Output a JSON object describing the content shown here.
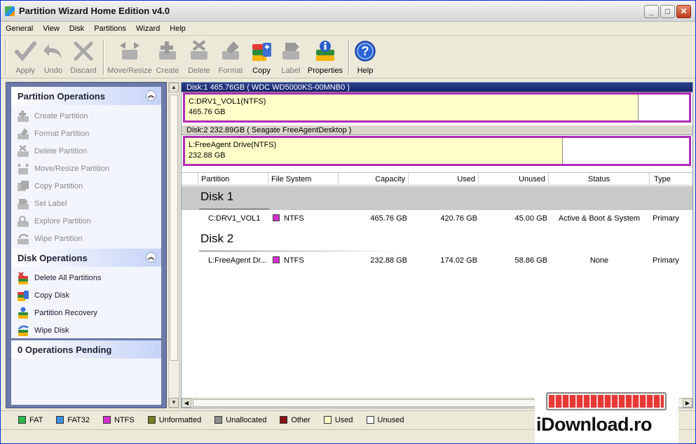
{
  "window": {
    "title": "Partition Wizard Home Edition v4.0"
  },
  "menu": [
    "General",
    "View",
    "Disk",
    "Partitions",
    "Wizard",
    "Help"
  ],
  "toolbar": {
    "apply": "Apply",
    "undo": "Undo",
    "discard": "Discard",
    "move_resize": "Move/Resize",
    "create": "Create",
    "delete": "Delete",
    "format": "Format",
    "copy": "Copy",
    "label": "Label",
    "properties": "Properties",
    "help": "Help"
  },
  "partition_operations": {
    "title": "Partition Operations",
    "items": [
      "Create Partition",
      "Format Partition",
      "Delete Partition",
      "Move/Resize Partition",
      "Copy Partition",
      "Set Label",
      "Explore Partition",
      "Wipe Partition"
    ]
  },
  "disk_operations": {
    "title": "Disk Operations",
    "items": [
      "Delete All Partitions",
      "Copy Disk",
      "Partition Recovery",
      "Wipe Disk"
    ]
  },
  "pending": {
    "title": "0 Operations Pending"
  },
  "diskmap": {
    "disk1": {
      "header": "Disk:1 465.76GB  ( WDC WD5000KS-00MNB0 )",
      "part_name": "C:DRV1_VOL1(NTFS)",
      "part_size": "465.76 GB",
      "used_fraction": 0.9
    },
    "disk2": {
      "header": "Disk:2 232.89GB  ( Seagate FreeAgentDesktop )",
      "part_name": "L:FreeAgent Drive(NTFS)",
      "part_size": "232.88 GB",
      "used_fraction": 0.75
    }
  },
  "table": {
    "columns": [
      "Partition",
      "File System",
      "Capacity",
      "Used",
      "Unused",
      "Status",
      "Type"
    ],
    "groups": [
      {
        "title": "Disk 1",
        "rows": [
          {
            "partition": "C:DRV1_VOL1",
            "fs": "NTFS",
            "capacity": "465.76 GB",
            "used": "420.76 GB",
            "unused": "45.00 GB",
            "status": "Active & Boot & System",
            "type": "Primary"
          }
        ]
      },
      {
        "title": "Disk 2",
        "rows": [
          {
            "partition": "L:FreeAgent Dr...",
            "fs": "NTFS",
            "capacity": "232.88 GB",
            "used": "174.02 GB",
            "unused": "58.86 GB",
            "status": "None",
            "type": "Primary"
          }
        ]
      }
    ]
  },
  "legend": [
    {
      "label": "FAT",
      "color": "#2db84a"
    },
    {
      "label": "FAT32",
      "color": "#3a8fe0"
    },
    {
      "label": "NTFS",
      "color": "#d22fcf"
    },
    {
      "label": "Unformatted",
      "color": "#7a7a1e"
    },
    {
      "label": "Unallocated",
      "color": "#8e8e8e"
    },
    {
      "label": "Other",
      "color": "#8a1414"
    },
    {
      "label": "Used",
      "color": "#ffffc8"
    },
    {
      "label": "Unused",
      "color": "#ffffff"
    }
  ],
  "watermark": {
    "text": "iDownload.ro"
  },
  "colors": {
    "ntfs": "#d22fcf",
    "selected_bar": "#b02bb8",
    "used_fill": "#ffffc8"
  }
}
